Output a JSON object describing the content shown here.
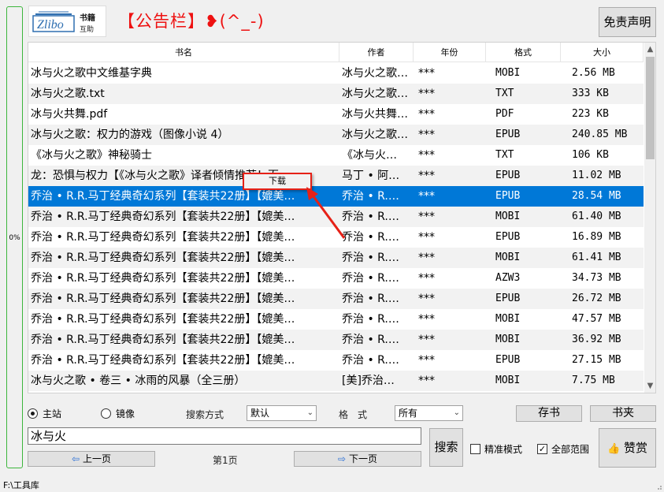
{
  "progress": {
    "label": "0%",
    "value": 0
  },
  "header": {
    "logo_text": "Zlibo",
    "logo_cn_1": "书籍",
    "logo_cn_2": "互助",
    "notice": "【公告栏】❥(^_-)",
    "disclaimer_button": "免责声明"
  },
  "table": {
    "columns": [
      "书名",
      "作者",
      "年份",
      "格式",
      "大小"
    ],
    "rows": [
      {
        "title": "冰与火之歌中文维基字典",
        "author": "冰与火之歌…",
        "year": "***",
        "format": "MOBI",
        "size": "2.56 MB"
      },
      {
        "title": "冰与火之歌.txt",
        "author": "冰与火之歌…",
        "year": "***",
        "format": "TXT",
        "size": "333 KB"
      },
      {
        "title": "冰与火共舞.pdf",
        "author": "冰与火共舞…",
        "year": "***",
        "format": "PDF",
        "size": "223 KB"
      },
      {
        "title": "冰与火之歌：权力的游戏（图像小说 4）",
        "author": "冰与火之歌…",
        "year": "***",
        "format": "EPUB",
        "size": "240.85 MB"
      },
      {
        "title": "《冰与火之歌》神秘骑士",
        "author": "《冰与火…",
        "year": "***",
        "format": "TXT",
        "size": "106 KB"
      },
      {
        "title": "龙：恐惧与权力【《冰与火之歌》译者倾情推荐！百…",
        "author": "马丁 • 阿…",
        "year": "***",
        "format": "EPUB",
        "size": "11.02 MB"
      },
      {
        "title": "乔治 • R.R.马丁经典奇幻系列【套装共22册】【媲美…",
        "author": "乔治 • R.…",
        "year": "***",
        "format": "EPUB",
        "size": "28.54 MB",
        "selected": true
      },
      {
        "title": "乔治 • R.R.马丁经典奇幻系列【套装共22册】【媲美…",
        "author": "乔治 • R.…",
        "year": "***",
        "format": "MOBI",
        "size": "61.40 MB"
      },
      {
        "title": "乔治 • R.R.马丁经典奇幻系列【套装共22册】【媲美…",
        "author": "乔治 • R.…",
        "year": "***",
        "format": "EPUB",
        "size": "16.89 MB"
      },
      {
        "title": "乔治 • R.R.马丁经典奇幻系列【套装共22册】【媲美…",
        "author": "乔治 • R.…",
        "year": "***",
        "format": "MOBI",
        "size": "61.41 MB"
      },
      {
        "title": "乔治 • R.R.马丁经典奇幻系列【套装共22册】【媲美…",
        "author": "乔治 • R.…",
        "year": "***",
        "format": "AZW3",
        "size": "34.73 MB"
      },
      {
        "title": "乔治 • R.R.马丁经典奇幻系列【套装共22册】【媲美…",
        "author": "乔治 • R.…",
        "year": "***",
        "format": "EPUB",
        "size": "26.72 MB"
      },
      {
        "title": "乔治 • R.R.马丁经典奇幻系列【套装共22册】【媲美…",
        "author": "乔治 • R.…",
        "year": "***",
        "format": "MOBI",
        "size": "47.57 MB"
      },
      {
        "title": "乔治 • R.R.马丁经典奇幻系列【套装共22册】【媲美…",
        "author": "乔治 • R.…",
        "year": "***",
        "format": "MOBI",
        "size": "36.92 MB"
      },
      {
        "title": "乔治 • R.R.马丁经典奇幻系列【套装共22册】【媲美…",
        "author": "乔治 • R.…",
        "year": "***",
        "format": "EPUB",
        "size": "27.15 MB"
      },
      {
        "title": "冰与火之歌 • 卷三 • 冰雨的风暴（全三册）",
        "author": "[美]乔治…",
        "year": "***",
        "format": "MOBI",
        "size": "7.75 MB"
      }
    ]
  },
  "context_menu": {
    "download": "下载"
  },
  "controls": {
    "radio_main": "主站",
    "radio_mirror": "镜像",
    "search_mode_label": "搜索方式",
    "search_mode_value": "默认",
    "format_label": "格　式",
    "format_value": "所有",
    "bookstore_button": "存书",
    "bookshelf_button": "书夹",
    "search_value": "冰与火",
    "search_button": "搜索",
    "exact_mode": "精准模式",
    "full_range": "全部范围",
    "donate_button": "赞赏",
    "prev_button": "上一页",
    "page_label": "第1页",
    "next_button": "下一页"
  },
  "status": {
    "path": "F:\\工具库"
  },
  "colors": {
    "selection": "#0078d7",
    "notice": "#e11111",
    "highlight": "#e62117",
    "progress_border": "#3cb63c"
  }
}
